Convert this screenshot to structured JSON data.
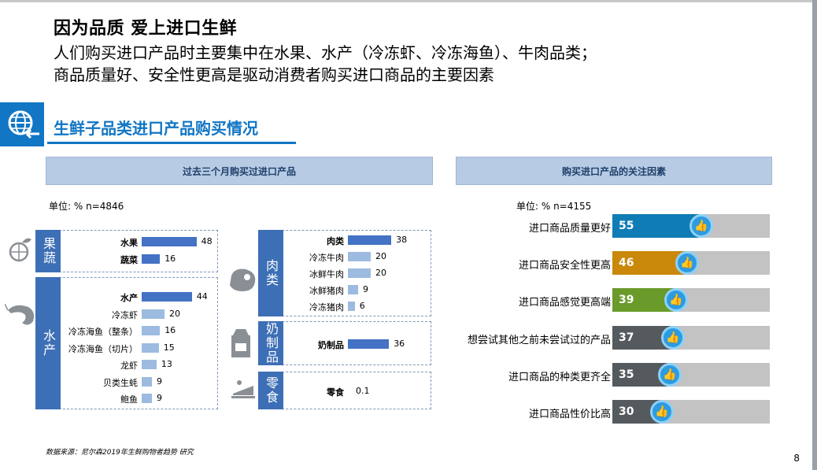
{
  "title": "因为品质 爱上进口生鲜",
  "subtitle_lines": [
    "人们购买进口产品时主要集中在水果、水产（冷冻虾、冷冻海鱼）、牛肉品类；",
    "商品质量好、安全性更高是驱动消费者购买进口商品的主要因素"
  ],
  "section_title": "生鲜子品类进口产品购买情况",
  "left_panel": {
    "banner": "过去三个月购买过进口产品",
    "unit": "单位: % n=4846"
  },
  "right_panel": {
    "banner": "购买进口产品的关注因素",
    "unit": "单位: % n=4155"
  },
  "source": "数据来源：尼尔森2019年生鲜购物者趋势 研究",
  "page_number": "8",
  "colors": {
    "accent": "#1176c4",
    "group_tag": "#3d6fb6",
    "bar_main": "#4472c4",
    "bar_sub": "#9dbbe0",
    "track": "#c3c3c3"
  },
  "chart_data": [
    {
      "type": "bar",
      "orientation": "horizontal",
      "unit": "%",
      "groups": [
        {
          "name": "果蔬",
          "icon": "fruit-icon",
          "items": [
            {
              "label": "水果",
              "value": 48,
              "main": true
            },
            {
              "label": "蔬菜",
              "value": 16,
              "main": true
            }
          ]
        },
        {
          "name": "水产",
          "icon": "shrimp-icon",
          "items": [
            {
              "label": "水产",
              "value": 44,
              "main": true
            },
            {
              "label": "冷冻虾",
              "value": 20,
              "main": false
            },
            {
              "label": "冷冻海鱼（整条）",
              "value": 16,
              "main": false
            },
            {
              "label": "冷冻海鱼（切片）",
              "value": 15,
              "main": false
            },
            {
              "label": "龙虾",
              "value": 13,
              "main": false
            },
            {
              "label": "贝类生蚝",
              "value": 9,
              "main": false
            },
            {
              "label": "鲍鱼",
              "value": 9,
              "main": false
            }
          ]
        },
        {
          "name": "肉类",
          "icon": "meat-icon",
          "items": [
            {
              "label": "肉类",
              "value": 38,
              "main": true
            },
            {
              "label": "冷冻牛肉",
              "value": 20,
              "main": false
            },
            {
              "label": "冰鲜牛肉",
              "value": 20,
              "main": false
            },
            {
              "label": "冰鲜猪肉",
              "value": 9,
              "main": false
            },
            {
              "label": "冷冻猪肉",
              "value": 6,
              "main": false
            }
          ]
        },
        {
          "name": "奶制品",
          "icon": "milk-icon",
          "items": [
            {
              "label": "奶制品",
              "value": 36,
              "main": true
            }
          ]
        },
        {
          "name": "零食",
          "icon": "cake-icon",
          "items": [
            {
              "label": "零食",
              "value": 0.1,
              "main": true
            }
          ]
        }
      ]
    },
    {
      "type": "bar",
      "orientation": "horizontal",
      "unit": "%",
      "categories": [
        "进口商品质量更好",
        "进口商品安全性更高",
        "进口商品感觉更高端",
        "想尝试其他之前未尝试过的产品",
        "进口商品的种类更齐全",
        "进口商品性价比高"
      ],
      "values": [
        55,
        46,
        39,
        37,
        35,
        30
      ],
      "colors": [
        "#0f7cb6",
        "#c9880a",
        "#6a9a2a",
        "#555a5e",
        "#555a5e",
        "#555a5e"
      ],
      "icon": "thumbs-up-icon"
    }
  ]
}
